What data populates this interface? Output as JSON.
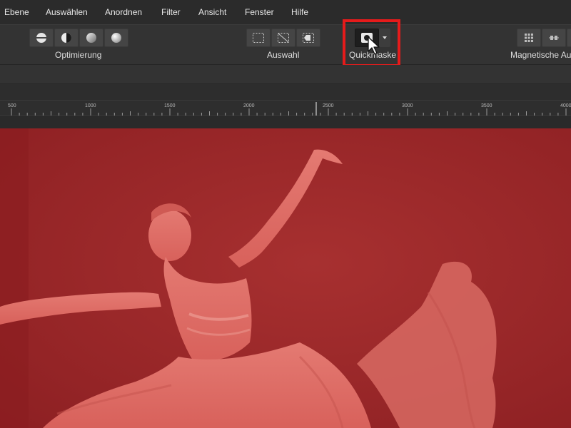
{
  "menu": {
    "items": [
      "Ebene",
      "Auswählen",
      "Anordnen",
      "Filter",
      "Ansicht",
      "Fenster",
      "Hilfe"
    ]
  },
  "toolbar": {
    "optimierung_label": "Optimierung",
    "auswahl_label": "Auswahl",
    "quickmaske_label": "Quickmaske",
    "magnetische_label": "Magnetische Au"
  },
  "ruler": {
    "labels": [
      "500",
      "1000",
      "1500",
      "2000",
      "2500",
      "3000",
      "3500",
      "4000"
    ]
  },
  "icons": {
    "optimierung": [
      "split-circle-icon",
      "half-circle-icon",
      "gradient-circle-icon",
      "soft-circle-icon"
    ],
    "auswahl": [
      "marquee-select-icon",
      "deselect-icon",
      "invert-select-icon"
    ],
    "quickmask": "quick-mask-icon",
    "magnetic": [
      "grid-snap-icon",
      "align-snap-icon"
    ]
  },
  "colors": {
    "mask_overlay": "#a52a2a",
    "highlight": "#e51b1b"
  }
}
